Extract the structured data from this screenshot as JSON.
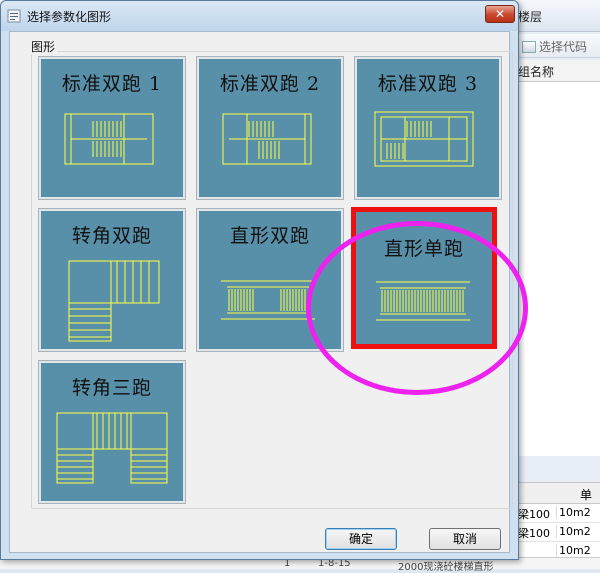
{
  "background_app": {
    "layer_tab": "楼层",
    "left_glyph": "卩",
    "select_code_label": "选择代码",
    "name_column_header": "组名称",
    "unit_column_header": "单位",
    "rows": [
      {
        "c1": "梁100",
        "c2": "10m2"
      },
      {
        "c1": "梁100",
        "c2": "10m2"
      },
      {
        "c1": "",
        "c2": "10m2"
      },
      {
        "c1": "",
        "c2": "10m2"
      }
    ],
    "bottom_strip": [
      "1",
      "1-8-15",
      "2000现浇砼楼梯直形"
    ]
  },
  "dialog": {
    "title": "选择参数化图形",
    "close_label": "✕",
    "group_label": "图形",
    "tiles": [
      {
        "label": "标准双跑 1",
        "selected": false
      },
      {
        "label": "标准双跑 2",
        "selected": false
      },
      {
        "label": "标准双跑 3",
        "selected": false
      },
      {
        "label": "转角双跑",
        "selected": false
      },
      {
        "label": "直形双跑",
        "selected": false
      },
      {
        "label": "直形单跑",
        "selected": true
      },
      {
        "label": "转角三跑",
        "selected": false
      }
    ],
    "ok_label": "确定",
    "cancel_label": "取消"
  },
  "colors": {
    "tile_bg": "#5990a9",
    "stair_lines": "#ffff44",
    "selected_border": "#ee1111",
    "annotation_ring": "#ee22ee"
  }
}
